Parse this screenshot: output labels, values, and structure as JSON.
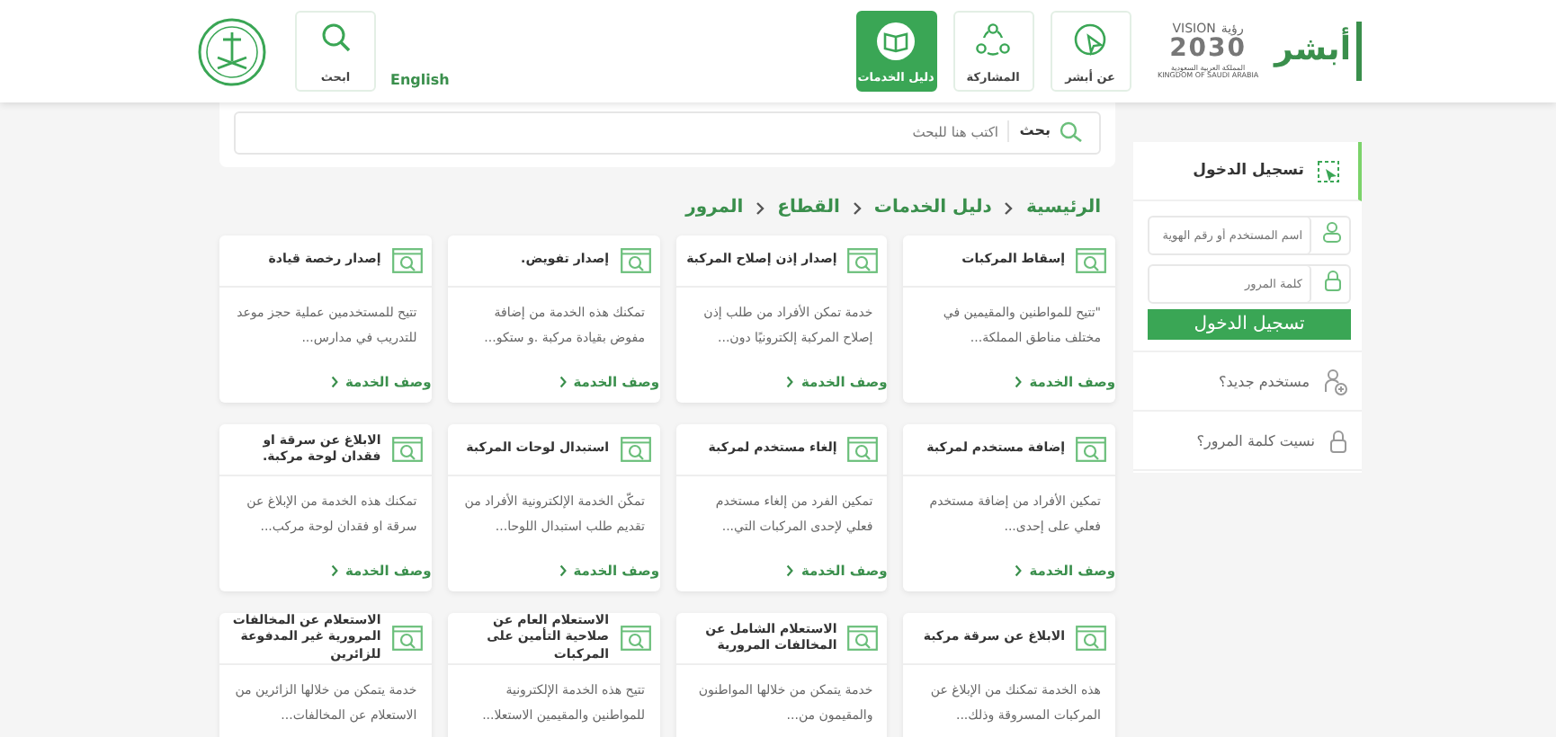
{
  "header": {
    "logo": {
      "wordmark": "أبشر",
      "vision": "VISION",
      "vision_ar": "رؤية",
      "year": "2030",
      "kingdom_ar": "المملكة العربية السعودية",
      "kingdom_en": "KINGDOM OF SAUDI ARABIA"
    },
    "nav": [
      {
        "label": "عن أبشر",
        "kind": "pointer",
        "selected": false
      },
      {
        "label": "المشاركة",
        "kind": "share",
        "selected": false
      },
      {
        "label": "دليل الخدمات",
        "kind": "book",
        "selected": true
      }
    ],
    "language_link": "English",
    "search_tile": {
      "label": "ابحث"
    }
  },
  "search": {
    "label": "بحث",
    "placeholder": "اكتب هنا للبحث"
  },
  "breadcrumb": [
    "الرئيسية",
    "دليل الخدمات",
    "القطاع",
    "المرور"
  ],
  "services": [
    {
      "title": "إسقاط المركبات",
      "description": "\"تتيح للمواطنين والمقيمين في مختلف مناطق المملكة...",
      "link": "وصف الخدمة"
    },
    {
      "title": "إصدار إذن إصلاح المركبة",
      "description": "خدمة تمكن الأفراد من طلب إذن إصلاح المركبة إلكترونيًا دون...",
      "link": "وصف الخدمة"
    },
    {
      "title": "إصدار تفويض.",
      "description": "تمكنك هذه الخدمة من إضافة مفوض بقيادة مركبة .و ستكو...",
      "link": "وصف الخدمة"
    },
    {
      "title": "إصدار رخصة قيادة",
      "description": "تتيح للمستخدمين عملية حجز موعد للتدريب في مدارس...",
      "link": "وصف الخدمة"
    },
    {
      "title": "إضافة مستخدم لمركبة",
      "description": "تمكين الأفراد من إضافة مستخدم فعلي على إحدى...",
      "link": "وصف الخدمة"
    },
    {
      "title": "إلغاء مستخدم لمركبة",
      "description": "تمكين الفرد من إلغاء مستخدم فعلي لإحدى المركبات التي...",
      "link": "وصف الخدمة"
    },
    {
      "title": "استبدال لوحات المركبة",
      "description": "تمكّن الخدمة الإلكترونية الأفراد من تقديم طلب استبدال اللوحا...",
      "link": "وصف الخدمة"
    },
    {
      "title": "الابلاغ عن سرقة او فقدان لوحة مركبة.",
      "description": "تمكنك هذه الخدمة من الإبلاغ عن سرقة او فقدان لوحة مركب...",
      "link": "وصف الخدمة"
    },
    {
      "title": "الابلاغ عن سرقة مركبة",
      "description": "هذه الخدمة تمكنك من الإبلاغ عن المركبات المسروقة وذلك..."
    },
    {
      "title": "الاستعلام الشامل عن المخالفات المرورية",
      "description": "خدمة يتمكن من خلالها المواطنون والمقيمون من..."
    },
    {
      "title": "الاستعلام العام عن صلاحية التأمين على المركبات",
      "description": "تتيح هذه الخدمة الإلكترونية للمواطنين والمقيمين الاستعلا..."
    },
    {
      "title": "الاستعلام عن المخالفات المرورية غير المدفوعة للزائرين",
      "description": "خدمة يتمكن من خلالها الزائرين من الاستعلام عن المخالفات..."
    }
  ],
  "login": {
    "title": "تسجيل الدخول",
    "username_placeholder": "اسم المستخدم أو رقم الهوية",
    "password_placeholder": "كلمة المرور",
    "button": "تسجيل الدخول",
    "links": [
      {
        "label": "مستخدم جديد؟",
        "kind": "new-user"
      },
      {
        "label": "نسيت كلمة المرور؟",
        "kind": "forgot"
      }
    ]
  }
}
